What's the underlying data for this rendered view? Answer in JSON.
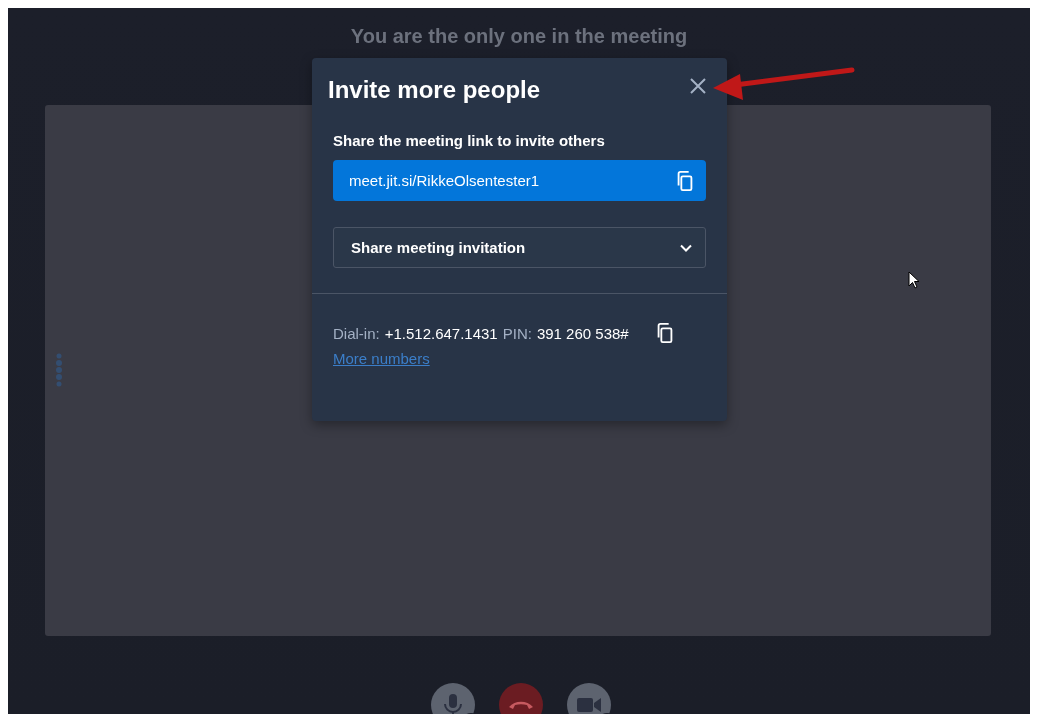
{
  "status": {
    "message": "You are the only one in the meeting"
  },
  "dialog": {
    "title": "Invite more people",
    "link_section": {
      "label": "Share the meeting link to invite others",
      "link": "meet.jit.si/RikkeOlsentester1"
    },
    "invitation_dropdown": {
      "label": "Share meeting invitation",
      "expanded": false
    },
    "dial_in": {
      "label": "Dial-in:",
      "number": "+1.512.647.1431",
      "pin_label": "PIN:",
      "pin": "391 260 538#",
      "more_link": "More numbers"
    }
  },
  "toolbar": {
    "buttons": [
      {
        "kind": "microphone"
      },
      {
        "kind": "hangup"
      },
      {
        "kind": "camera"
      }
    ]
  }
}
